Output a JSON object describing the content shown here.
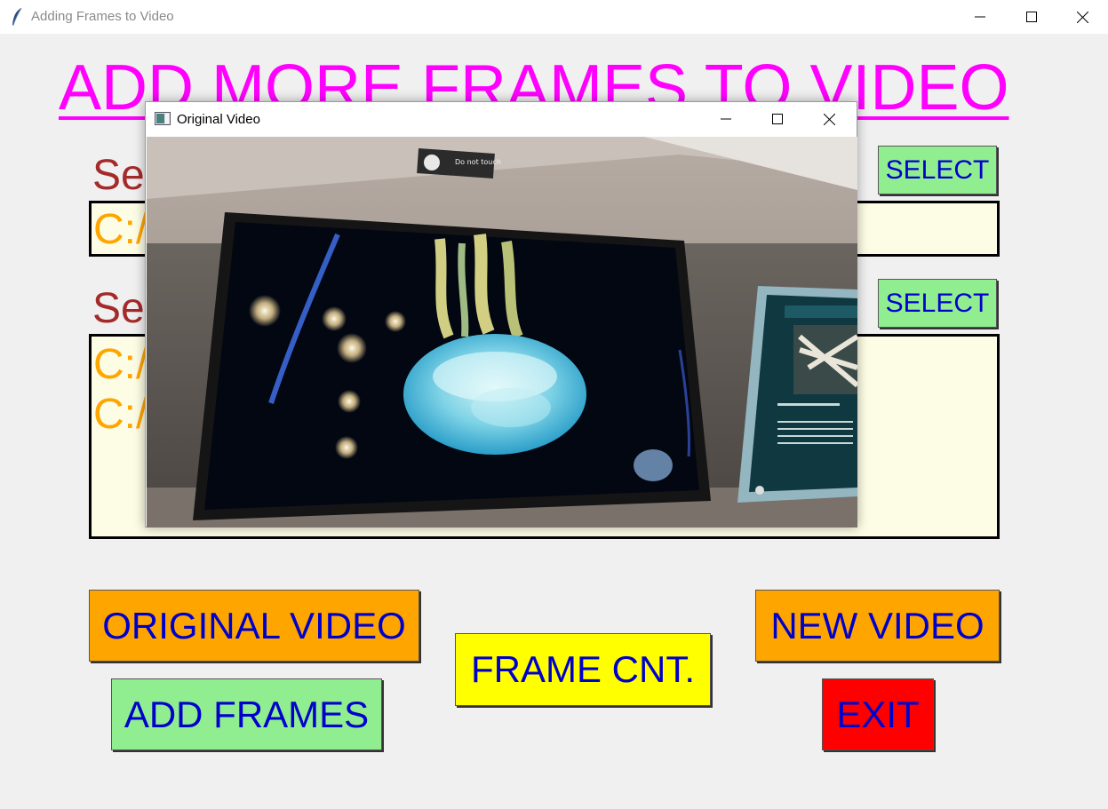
{
  "window": {
    "title": "Adding Frames to Video",
    "icon": "feather-icon"
  },
  "heading": "ADD MORE FRAMES TO VIDEO",
  "video_section": {
    "label": "Se",
    "path": "C:/",
    "select_label": "SELECT"
  },
  "frames_section": {
    "label": "Se",
    "paths": [
      "C:/",
      "C:/"
    ],
    "select_label": "SELECT"
  },
  "buttons": {
    "original_video": "ORIGINAL VIDEO",
    "frame_count": "FRAME CNT.",
    "new_video": "NEW VIDEO",
    "add_frames": "ADD FRAMES",
    "exit": "EXIT"
  },
  "video_window": {
    "title": "Original Video",
    "sign_text": "Do not touch"
  },
  "colors": {
    "heading": "#ff00ff",
    "label": "#a52a2a",
    "path_text": "#ffa500",
    "button_text": "#0000cc",
    "orange_button": "#ffa500",
    "green_button": "#90ee90",
    "yellow_button": "#ffff00",
    "red_button": "#ff0000",
    "box_fill": "#fdfde5"
  }
}
